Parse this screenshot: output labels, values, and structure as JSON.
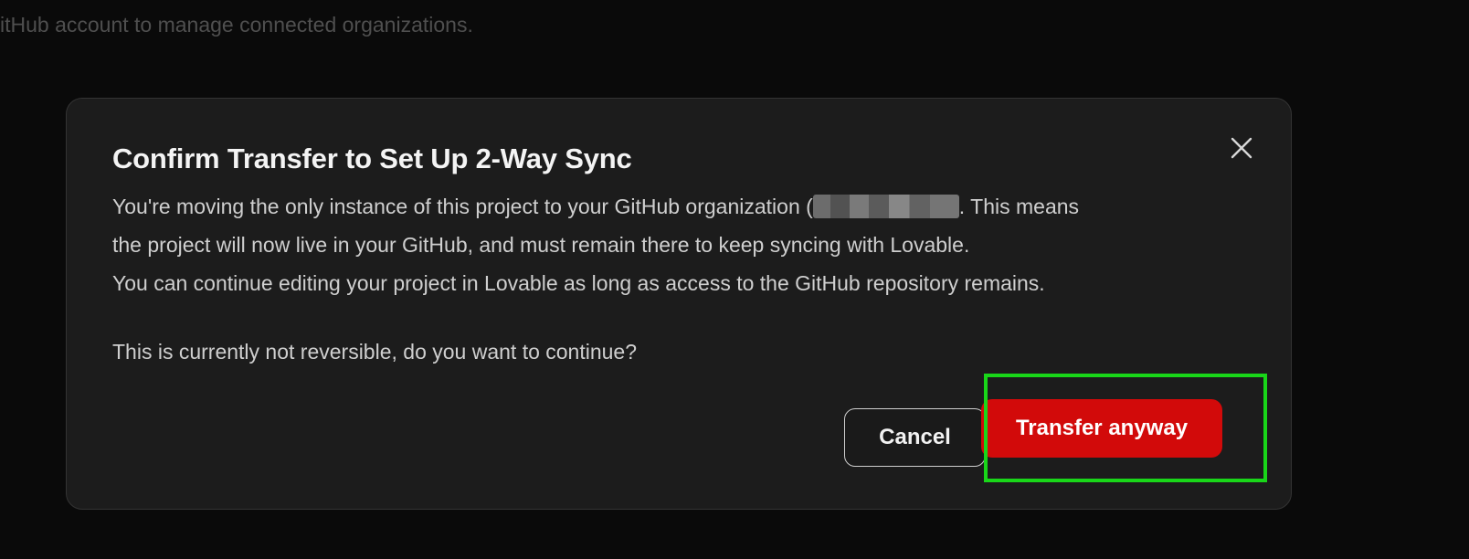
{
  "background": {
    "text": "itHub account to manage connected organizations."
  },
  "modal": {
    "title": "Confirm Transfer to Set Up 2-Way Sync",
    "body_line1_before": "You're moving the only instance of this project to your GitHub organization (",
    "body_line1_after": ". This means",
    "body_line2": "the project will now live in your GitHub, and must remain there to keep syncing with Lovable.",
    "body_line3": "You can continue editing your project in Lovable as long as access to the GitHub repository remains.",
    "question": "This is currently not reversible, do you want to continue?",
    "cancel_label": "Cancel",
    "transfer_label": "Transfer anyway",
    "close_icon": "close-icon"
  },
  "colors": {
    "background": "#0a0a0a",
    "modal": "#1c1c1c",
    "primary_button": "#d20a0a",
    "highlight": "#19d619"
  }
}
